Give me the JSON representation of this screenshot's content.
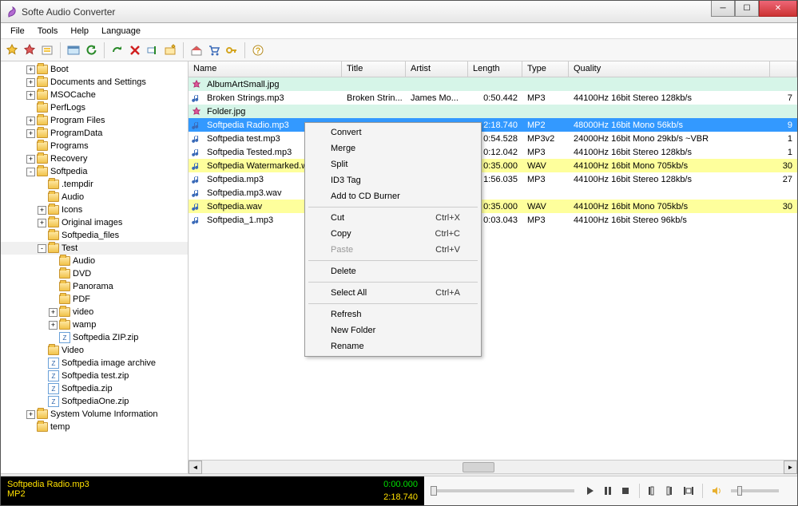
{
  "window": {
    "title": "Softe Audio Converter"
  },
  "menu": {
    "file": "File",
    "tools": "Tools",
    "help": "Help",
    "language": "Language"
  },
  "columns": {
    "name": "Name",
    "title": "Title",
    "artist": "Artist",
    "length": "Length",
    "type": "Type",
    "quality": "Quality"
  },
  "tree": [
    {
      "indent": 2,
      "exp": "+",
      "label": "Boot",
      "kind": "f"
    },
    {
      "indent": 2,
      "exp": "+",
      "label": "Documents and Settings",
      "kind": "f"
    },
    {
      "indent": 2,
      "exp": "+",
      "label": "MSOCache",
      "kind": "f"
    },
    {
      "indent": 2,
      "exp": "",
      "label": "PerfLogs",
      "kind": "f"
    },
    {
      "indent": 2,
      "exp": "+",
      "label": "Program Files",
      "kind": "f"
    },
    {
      "indent": 2,
      "exp": "+",
      "label": "ProgramData",
      "kind": "f"
    },
    {
      "indent": 2,
      "exp": "",
      "label": "Programs",
      "kind": "f"
    },
    {
      "indent": 2,
      "exp": "+",
      "label": "Recovery",
      "kind": "f"
    },
    {
      "indent": 2,
      "exp": "-",
      "label": "Softpedia",
      "kind": "f"
    },
    {
      "indent": 3,
      "exp": "",
      "label": ".tempdir",
      "kind": "f"
    },
    {
      "indent": 3,
      "exp": "",
      "label": "Audio",
      "kind": "f"
    },
    {
      "indent": 3,
      "exp": "+",
      "label": "Icons",
      "kind": "f"
    },
    {
      "indent": 3,
      "exp": "+",
      "label": "Original images",
      "kind": "f"
    },
    {
      "indent": 3,
      "exp": "",
      "label": "Softpedia_files",
      "kind": "f"
    },
    {
      "indent": 3,
      "exp": "-",
      "label": "Test",
      "kind": "f",
      "sel": true
    },
    {
      "indent": 4,
      "exp": "",
      "label": "Audio",
      "kind": "f"
    },
    {
      "indent": 4,
      "exp": "",
      "label": "DVD",
      "kind": "f"
    },
    {
      "indent": 4,
      "exp": "",
      "label": "Panorama",
      "kind": "f"
    },
    {
      "indent": 4,
      "exp": "",
      "label": "PDF",
      "kind": "f"
    },
    {
      "indent": 4,
      "exp": "+",
      "label": "video",
      "kind": "f"
    },
    {
      "indent": 4,
      "exp": "+",
      "label": "wamp",
      "kind": "f"
    },
    {
      "indent": 4,
      "exp": "",
      "label": "Softpedia ZIP.zip",
      "kind": "z"
    },
    {
      "indent": 3,
      "exp": "",
      "label": "Video",
      "kind": "f"
    },
    {
      "indent": 3,
      "exp": "",
      "label": "Softpedia image archive",
      "kind": "z"
    },
    {
      "indent": 3,
      "exp": "",
      "label": "Softpedia test.zip",
      "kind": "z"
    },
    {
      "indent": 3,
      "exp": "",
      "label": "Softpedia.zip",
      "kind": "z"
    },
    {
      "indent": 3,
      "exp": "",
      "label": "SoftpediaOne.zip",
      "kind": "z"
    },
    {
      "indent": 2,
      "exp": "+",
      "label": "System Volume Information",
      "kind": "f"
    },
    {
      "indent": 2,
      "exp": "",
      "label": "temp",
      "kind": "f"
    }
  ],
  "files": [
    {
      "name": "AlbumArtSmall.jpg",
      "title": "",
      "artist": "",
      "length": "",
      "type": "",
      "quality": "",
      "cls": "jpg",
      "ico": "img",
      "last": ""
    },
    {
      "name": "Broken Strings.mp3",
      "title": "Broken Strin...",
      "artist": "James Mo...",
      "length": "0:50.442",
      "type": "MP3",
      "quality": "44100Hz 16bit Stereo 128kb/s",
      "cls": "mp3",
      "ico": "aud",
      "last": "7"
    },
    {
      "name": "Folder.jpg",
      "title": "",
      "artist": "",
      "length": "",
      "type": "",
      "quality": "",
      "cls": "jpg",
      "ico": "img",
      "last": ""
    },
    {
      "name": "Softpedia Radio.mp3",
      "title": "",
      "artist": "",
      "length": "2:18.740",
      "type": "MP2",
      "quality": "48000Hz 16bit Mono 56kb/s",
      "cls": "sel",
      "ico": "aud",
      "last": "9"
    },
    {
      "name": "Softpedia test.mp3",
      "title": "",
      "artist": "",
      "length": "0:54.528",
      "type": "MP3v2",
      "quality": "24000Hz 16bit Mono 29kb/s ~VBR",
      "cls": "mp3",
      "ico": "aud",
      "last": "1"
    },
    {
      "name": "Softpedia Tested.mp3",
      "title": "",
      "artist": "",
      "length": "0:12.042",
      "type": "MP3",
      "quality": "44100Hz 16bit Stereo 128kb/s",
      "cls": "mp3",
      "ico": "aud",
      "last": "1"
    },
    {
      "name": "Softpedia Watermarked.wav",
      "title": "",
      "artist": "",
      "length": "0:35.000",
      "type": "WAV",
      "quality": "44100Hz 16bit Mono 705kb/s",
      "cls": "wav",
      "ico": "aud",
      "last": "30"
    },
    {
      "name": "Softpedia.mp3",
      "title": "",
      "artist": "",
      "length": "1:56.035",
      "type": "MP3",
      "quality": "44100Hz 16bit Stereo 128kb/s",
      "cls": "mp3",
      "ico": "aud",
      "last": "27"
    },
    {
      "name": "Softpedia.mp3.wav",
      "title": "",
      "artist": "",
      "length": "",
      "type": "",
      "quality": "",
      "cls": "alt",
      "ico": "aud",
      "last": ""
    },
    {
      "name": "Softpedia.wav",
      "title": "",
      "artist": "",
      "length": "0:35.000",
      "type": "WAV",
      "quality": "44100Hz 16bit Mono 705kb/s",
      "cls": "wav",
      "ico": "aud",
      "last": "30"
    },
    {
      "name": "Softpedia_1.mp3",
      "title": "",
      "artist": "",
      "length": "0:03.043",
      "type": "MP3",
      "quality": "44100Hz 16bit Stereo 96kb/s",
      "cls": "mp3",
      "ico": "aud",
      "last": ""
    }
  ],
  "context": {
    "convert": "Convert",
    "merge": "Merge",
    "split": "Split",
    "id3": "ID3 Tag",
    "cd": "Add to CD Burner",
    "cut": "Cut",
    "copy": "Copy",
    "paste": "Paste",
    "delete": "Delete",
    "selectall": "Select All",
    "refresh": "Refresh",
    "newfolder": "New Folder",
    "rename": "Rename",
    "sc_cut": "Ctrl+X",
    "sc_copy": "Ctrl+C",
    "sc_paste": "Ctrl+V",
    "sc_selectall": "Ctrl+A"
  },
  "nowplaying": {
    "name": "Softpedia Radio.mp3",
    "type": "MP2",
    "elapsed": "0:00.000",
    "total": "2:18.740"
  }
}
